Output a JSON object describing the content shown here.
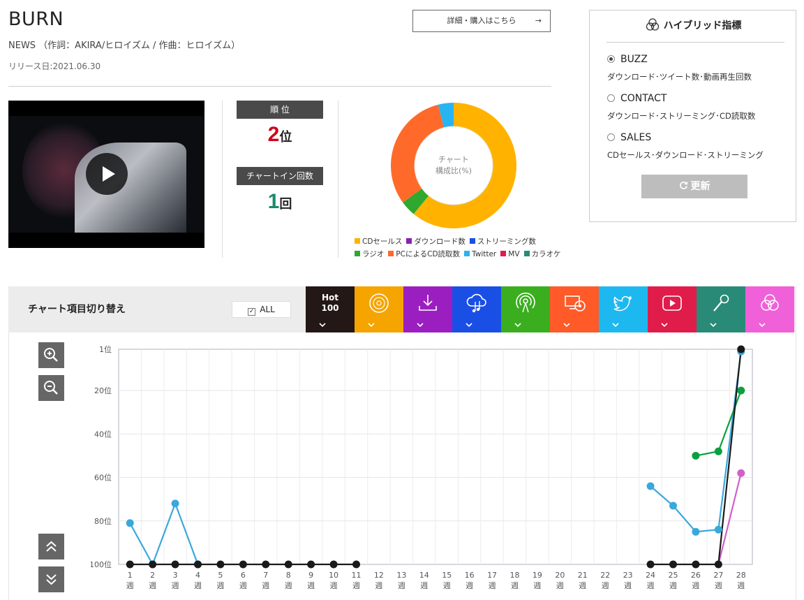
{
  "song": {
    "title": "BURN",
    "credit": "NEWS （作詞：AKIRA/ヒロイズム / 作曲：ヒロイズム）",
    "release": "リリース日:2021.06.30"
  },
  "detail_button": {
    "label": "詳細・購入はこちら",
    "arrow": "→"
  },
  "rank": {
    "rank_label": "順 位",
    "rank_value": "2",
    "rank_unit": "位",
    "chartin_label": "チャートイン回数",
    "chartin_value": "1",
    "chartin_unit": "回",
    "rank_color": "#d0021b",
    "chartin_color": "#1a8a6e"
  },
  "donut": {
    "center_line1": "チャート",
    "center_line2": "構成比(%)",
    "slices": [
      {
        "name": "CDセールス",
        "value": 61,
        "color": "#ffb300"
      },
      {
        "name": "ラジオ",
        "value": 4,
        "color": "#2ea82e"
      },
      {
        "name": "PCによるCD読取数",
        "value": 31,
        "color": "#ff6a2a"
      },
      {
        "name": "Twitter",
        "value": 4,
        "color": "#28b4f0"
      }
    ]
  },
  "legend": [
    {
      "label": "CDセールス",
      "color": "#ffb300"
    },
    {
      "label": "ダウンロード数",
      "color": "#8b1fb0"
    },
    {
      "label": "ストリーミング数",
      "color": "#1a4fe6"
    },
    {
      "label": "ラジオ",
      "color": "#2ea82e"
    },
    {
      "label": "PCによるCD読取数",
      "color": "#ff6a2a"
    },
    {
      "label": "Twitter",
      "color": "#28b4f0"
    },
    {
      "label": "MV",
      "color": "#e31b4b"
    },
    {
      "label": "カラオケ",
      "color": "#2a8a78"
    }
  ],
  "hybrid": {
    "title": "ハイブリッド指標",
    "options": [
      {
        "label": "BUZZ",
        "desc": "ダウンロード･ツイート数･動画再生回数",
        "selected": true
      },
      {
        "label": "CONTACT",
        "desc": "ダウンロード･ストリーミング･CD読取数",
        "selected": false
      },
      {
        "label": "SALES",
        "desc": "CDセールス･ダウンロード･ストリーミング",
        "selected": false
      }
    ],
    "update_label": "更新",
    "update_icon": "refresh-icon"
  },
  "toolbar": {
    "title": "チャート項目切り替え",
    "all_label": "ALL",
    "all_check": "✓",
    "hot_label_1": "Hot",
    "hot_label_2": "100",
    "chevron": "⌄",
    "tabs": [
      {
        "name": "hot100",
        "color": "#231815"
      },
      {
        "name": "cd-icon",
        "color": "#f5a400"
      },
      {
        "name": "download-icon",
        "color": "#9b1fc0"
      },
      {
        "name": "streaming-icon",
        "color": "#1a4fe6"
      },
      {
        "name": "radio-icon",
        "color": "#3aae1f"
      },
      {
        "name": "pc-cd-icon",
        "color": "#ff5a28"
      },
      {
        "name": "twitter-icon",
        "color": "#1eb8f0"
      },
      {
        "name": "youtube-icon",
        "color": "#e01c4a"
      },
      {
        "name": "karaoke-icon",
        "color": "#2a8a78"
      },
      {
        "name": "hybrid-icon",
        "color": "#f060d8"
      }
    ]
  },
  "zoom": {
    "in": "zoom-in-icon",
    "out": "zoom-out-icon",
    "top": "double-chevron-up-icon",
    "bottom": "double-chevron-down-icon"
  },
  "chart_data": {
    "type": "line",
    "y_ticks": [
      "1位",
      "20位",
      "40位",
      "60位",
      "80位",
      "100位"
    ],
    "y_tick_values": [
      1,
      20,
      40,
      60,
      80,
      100
    ],
    "ylim": [
      1,
      100
    ],
    "y_inverted": true,
    "x_weeks": [
      1,
      2,
      3,
      4,
      5,
      6,
      7,
      8,
      9,
      10,
      11,
      12,
      13,
      14,
      15,
      16,
      17,
      18,
      19,
      20,
      21,
      22,
      23,
      24,
      25,
      26,
      27,
      28
    ],
    "x_unit": "週",
    "series": [
      {
        "color": "#39a8dc",
        "points": [
          [
            1,
            81
          ],
          [
            2,
            100
          ],
          [
            3,
            72
          ],
          [
            4,
            100
          ],
          [
            24,
            64
          ],
          [
            25,
            73
          ],
          [
            26,
            85
          ],
          [
            27,
            84
          ],
          [
            28,
            2
          ]
        ]
      },
      {
        "color": "#0aa040",
        "points": [
          [
            26,
            50
          ],
          [
            27,
            48
          ],
          [
            28,
            20
          ]
        ]
      },
      {
        "color": "#d060c8",
        "points": [
          [
            27,
            100
          ],
          [
            28,
            58
          ]
        ]
      },
      {
        "color": "#1a1a1a",
        "points": [
          [
            1,
            100
          ],
          [
            2,
            100
          ],
          [
            3,
            100
          ],
          [
            4,
            100
          ],
          [
            5,
            100
          ],
          [
            6,
            100
          ],
          [
            7,
            100
          ],
          [
            8,
            100
          ],
          [
            9,
            100
          ],
          [
            10,
            100
          ],
          [
            11,
            100
          ]
        ],
        "segment2": [
          [
            24,
            100
          ],
          [
            25,
            100
          ],
          [
            26,
            100
          ],
          [
            27,
            100
          ],
          [
            28,
            1
          ]
        ]
      }
    ]
  }
}
